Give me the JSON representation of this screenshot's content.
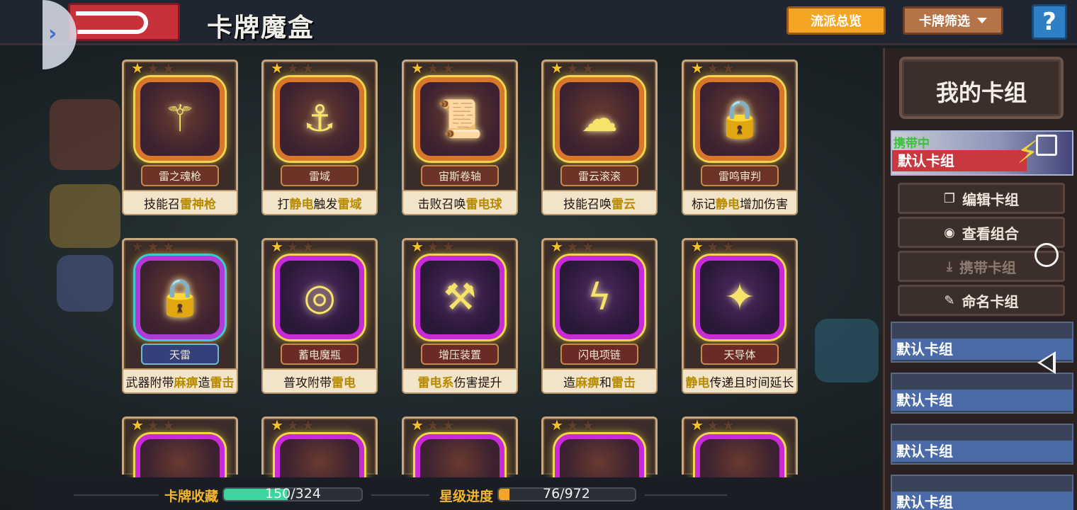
{
  "header": {
    "title": "卡牌魔盒",
    "overview_label": "流派总览",
    "filter_label": "卡牌筛选",
    "help_label": "?"
  },
  "cards": [
    {
      "name": "雷之魂枪",
      "desc_parts": [
        "技能召",
        "雷神枪"
      ],
      "style": "gold",
      "stars": 1
    },
    {
      "name": "雷域",
      "desc_parts": [
        "打",
        "静电",
        "触发",
        "雷域"
      ],
      "style": "gold",
      "stars": 1
    },
    {
      "name": "宙斯卷轴",
      "desc_parts": [
        "击败召唤",
        "雷电球"
      ],
      "style": "gold",
      "stars": 1
    },
    {
      "name": "雷云滚滚",
      "desc_parts": [
        "技能召唤",
        "雷云"
      ],
      "style": "gold",
      "stars": 1
    },
    {
      "name": "雷鸣审判",
      "desc_parts": [
        "标记",
        "静电",
        "增加伤害"
      ],
      "style": "gold",
      "stars": 1
    },
    {
      "name": "天雷",
      "desc_parts": [
        "武器附带",
        "麻痹",
        "造",
        "雷击"
      ],
      "style": "ornate",
      "stars": 0
    },
    {
      "name": "蓄电魔瓶",
      "desc_parts": [
        "普攻附带",
        "雷电"
      ],
      "style": "purple",
      "stars": 1
    },
    {
      "name": "增压装置",
      "desc_parts": [
        "雷电系",
        "伤害提升"
      ],
      "style": "purple",
      "stars": 1
    },
    {
      "name": "闪电项链",
      "desc_parts": [
        "造",
        "麻痹",
        "和",
        "雷击"
      ],
      "style": "purple",
      "stars": 1
    },
    {
      "name": "天导体",
      "desc_parts": [
        "静电",
        "传递且时间延长"
      ],
      "style": "purple",
      "stars": 1
    }
  ],
  "deck_panel": {
    "title": "我的卡组",
    "carrying_badge": "携带中",
    "active_deck_name": "默认卡组",
    "buttons": {
      "edit": "编辑卡组",
      "view": "查看组合",
      "carry": "携带卡组",
      "rename": "命名卡组"
    },
    "slots": [
      "默认卡组",
      "默认卡组",
      "默认卡组",
      "默认卡组"
    ]
  },
  "stats": {
    "collection_label": "卡牌收藏",
    "collection_value": "150/324",
    "collection_fraction": 0.463,
    "star_label": "星级进度",
    "star_value": "76/972",
    "star_fraction": 0.078
  },
  "colors": {
    "collection_fill": "#3bd6a0",
    "star_fill": "#f5a524",
    "highlight_text": "#b88a00"
  },
  "icons": {
    "card_art": [
      "spear-icon",
      "lightning-anchor-icon",
      "scroll-icon",
      "storm-cloud-icon",
      "lock-icon",
      "lock-icon",
      "orb-icon",
      "hammer-icon",
      "necklace-icon",
      "conductor-icon"
    ]
  }
}
